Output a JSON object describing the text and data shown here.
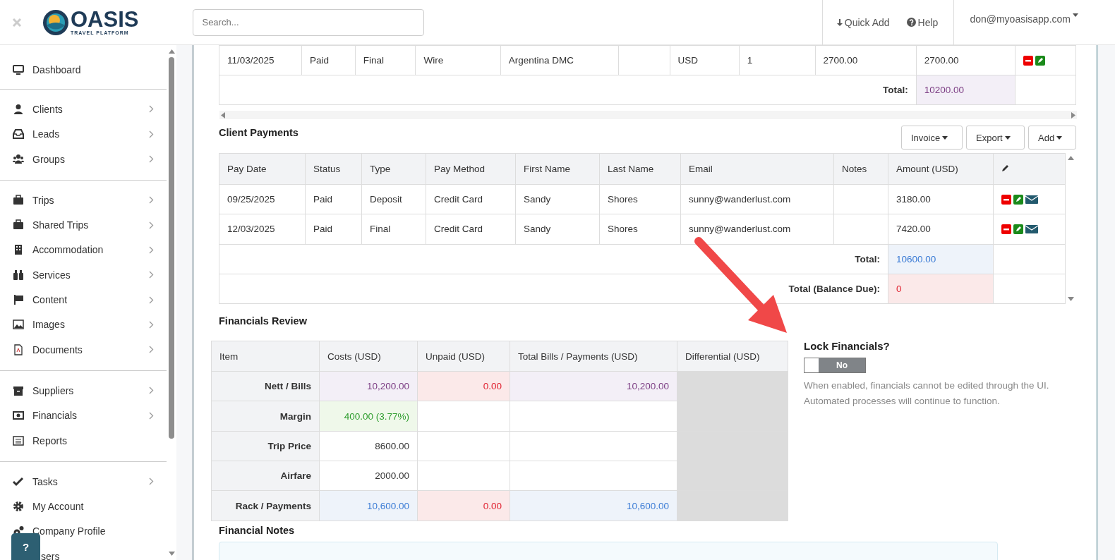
{
  "header": {
    "logo": {
      "name": "OASIS",
      "tagline": "TRAVEL PLATFORM"
    },
    "search": {
      "placeholder": "Search..."
    },
    "quick_add": "Quick Add",
    "help": "Help",
    "user": "don@myoasisapp.com"
  },
  "sidebar": {
    "groups": [
      {
        "items": [
          {
            "label": "Dashboard",
            "submenu": false
          }
        ]
      },
      {
        "items": [
          {
            "label": "Clients",
            "submenu": true
          },
          {
            "label": "Leads",
            "submenu": true
          },
          {
            "label": "Groups",
            "submenu": true
          }
        ]
      },
      {
        "items": [
          {
            "label": "Trips",
            "submenu": true
          },
          {
            "label": "Shared Trips",
            "submenu": true
          },
          {
            "label": "Accommodation",
            "submenu": true
          },
          {
            "label": "Services",
            "submenu": true
          },
          {
            "label": "Content",
            "submenu": true
          },
          {
            "label": "Images",
            "submenu": true
          },
          {
            "label": "Documents",
            "submenu": true
          }
        ]
      },
      {
        "items": [
          {
            "label": "Suppliers",
            "submenu": true
          },
          {
            "label": "Financials",
            "submenu": true
          },
          {
            "label": "Reports",
            "submenu": false
          }
        ]
      },
      {
        "items": [
          {
            "label": "Tasks",
            "submenu": true
          },
          {
            "label": "My Account",
            "submenu": false
          },
          {
            "label": "Company Profile",
            "submenu": false
          },
          {
            "label": "sers",
            "submenu": false
          }
        ]
      }
    ],
    "help_button": "?"
  },
  "supplier_bills": {
    "rows": [
      {
        "cells": [
          "11/03/2025",
          "Paid",
          "Final",
          "Wire",
          "Argentina DMC",
          "",
          "USD",
          "1",
          "2700.00",
          "2700.00"
        ]
      }
    ],
    "total_label": "Total:",
    "total": "10200.00"
  },
  "client_payments": {
    "title": "Client Payments",
    "buttons": [
      {
        "label": "Invoice"
      },
      {
        "label": "Export"
      },
      {
        "label": "Add"
      }
    ],
    "columns": [
      "Pay Date",
      "Status",
      "Type",
      "Pay Method",
      "First Name",
      "Last Name",
      "Email",
      "Notes",
      "Amount (USD)"
    ],
    "rows": [
      {
        "cells": [
          "09/25/2025",
          "Paid",
          "Deposit",
          "Credit Card",
          "Sandy",
          "Shores",
          "sunny@wanderlust.com",
          "",
          "3180.00"
        ]
      },
      {
        "cells": [
          "12/03/2025",
          "Paid",
          "Final",
          "Credit Card",
          "Sandy",
          "Shores",
          "sunny@wanderlust.com",
          "",
          "7420.00"
        ]
      }
    ],
    "totals": [
      {
        "label": "Total:",
        "value": "10600.00",
        "kind": "blue"
      },
      {
        "label": "Total (Balance Due):",
        "value": "0",
        "kind": "red"
      }
    ]
  },
  "financials_review": {
    "title": "Financials Review",
    "columns": [
      "Item",
      "Costs (USD)",
      "Unpaid (USD)",
      "Total Bills / Payments (USD)",
      "Differential (USD)"
    ],
    "rows": [
      {
        "cells": [
          {
            "text": "Nett / Bills",
            "kind": "label"
          },
          {
            "text": "10,200.00",
            "kind": "purple"
          },
          {
            "text": "0.00",
            "kind": "red"
          },
          {
            "text": "10,200.00",
            "kind": "purple"
          },
          {
            "text": "",
            "kind": "diff"
          }
        ]
      },
      {
        "cells": [
          {
            "text": "Margin",
            "kind": "label"
          },
          {
            "text": "400.00 (3.77%)",
            "kind": "green"
          },
          {
            "text": "",
            "kind": "plain"
          },
          {
            "text": "",
            "kind": "plain"
          },
          {
            "text": "",
            "kind": "diff"
          }
        ]
      },
      {
        "cells": [
          {
            "text": "Trip Price",
            "kind": "label"
          },
          {
            "text": "8600.00",
            "kind": "plain"
          },
          {
            "text": "",
            "kind": "plain"
          },
          {
            "text": "",
            "kind": "plain"
          },
          {
            "text": "",
            "kind": "diff"
          }
        ]
      },
      {
        "cells": [
          {
            "text": "Airfare",
            "kind": "label"
          },
          {
            "text": "2000.00",
            "kind": "plain"
          },
          {
            "text": "",
            "kind": "plain"
          },
          {
            "text": "",
            "kind": "plain"
          },
          {
            "text": "",
            "kind": "diff"
          }
        ]
      },
      {
        "cells": [
          {
            "text": "Rack / Payments",
            "kind": "label"
          },
          {
            "text": "10,600.00",
            "kind": "blue"
          },
          {
            "text": "0.00",
            "kind": "red"
          },
          {
            "text": "10,600.00",
            "kind": "blue"
          },
          {
            "text": "",
            "kind": "diff"
          }
        ]
      }
    ]
  },
  "lock": {
    "title": "Lock Financials?",
    "toggle": {
      "label": "No",
      "on": false
    },
    "note": "When enabled, financials cannot be edited through the UI. Automated processes will continue to function."
  },
  "financial_notes": {
    "title": "Financial Notes"
  }
}
